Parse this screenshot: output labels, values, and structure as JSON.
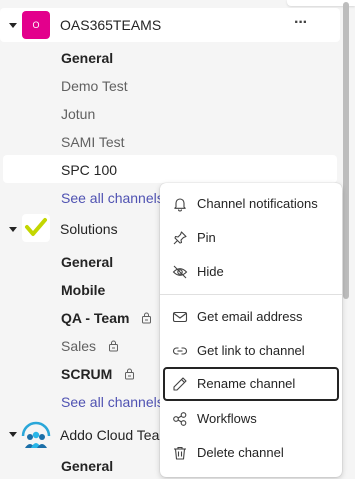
{
  "teams": [
    {
      "name": "OAS365TEAMS",
      "avatar_letter": "O",
      "avatar_color": "#e3008c",
      "more_label": "···",
      "channels": [
        {
          "label": "General",
          "style": "bold"
        },
        {
          "label": "Demo Test",
          "style": "muted"
        },
        {
          "label": "Jotun",
          "style": "muted"
        },
        {
          "label": "SAMI Test",
          "style": "muted"
        },
        {
          "label": "SPC 100",
          "style": "selected"
        }
      ],
      "see_all": "See all channels"
    },
    {
      "name": "Solutions",
      "channels": [
        {
          "label": "General",
          "style": "bold"
        },
        {
          "label": "Mobile",
          "style": "bold"
        },
        {
          "label": "QA - Team",
          "style": "bold",
          "private": true
        },
        {
          "label": "Sales",
          "style": "muted",
          "private": true
        },
        {
          "label": "SCRUM",
          "style": "bold",
          "private": true
        }
      ],
      "see_all": "See all channels"
    },
    {
      "name": "Addo Cloud Team",
      "channels": [
        {
          "label": "General",
          "style": "bold"
        }
      ]
    }
  ],
  "context_menu": {
    "items": [
      {
        "label": "Channel notifications",
        "icon": "bell-icon"
      },
      {
        "label": "Pin",
        "icon": "pin-icon"
      },
      {
        "label": "Hide",
        "icon": "eye-off-icon"
      },
      {
        "label": "Get email address",
        "icon": "mail-icon"
      },
      {
        "label": "Get link to channel",
        "icon": "link-icon"
      },
      {
        "label": "Rename channel",
        "icon": "pencil-icon",
        "focused": true
      },
      {
        "label": "Workflows",
        "icon": "workflows-icon"
      },
      {
        "label": "Delete channel",
        "icon": "trash-icon"
      }
    ]
  }
}
